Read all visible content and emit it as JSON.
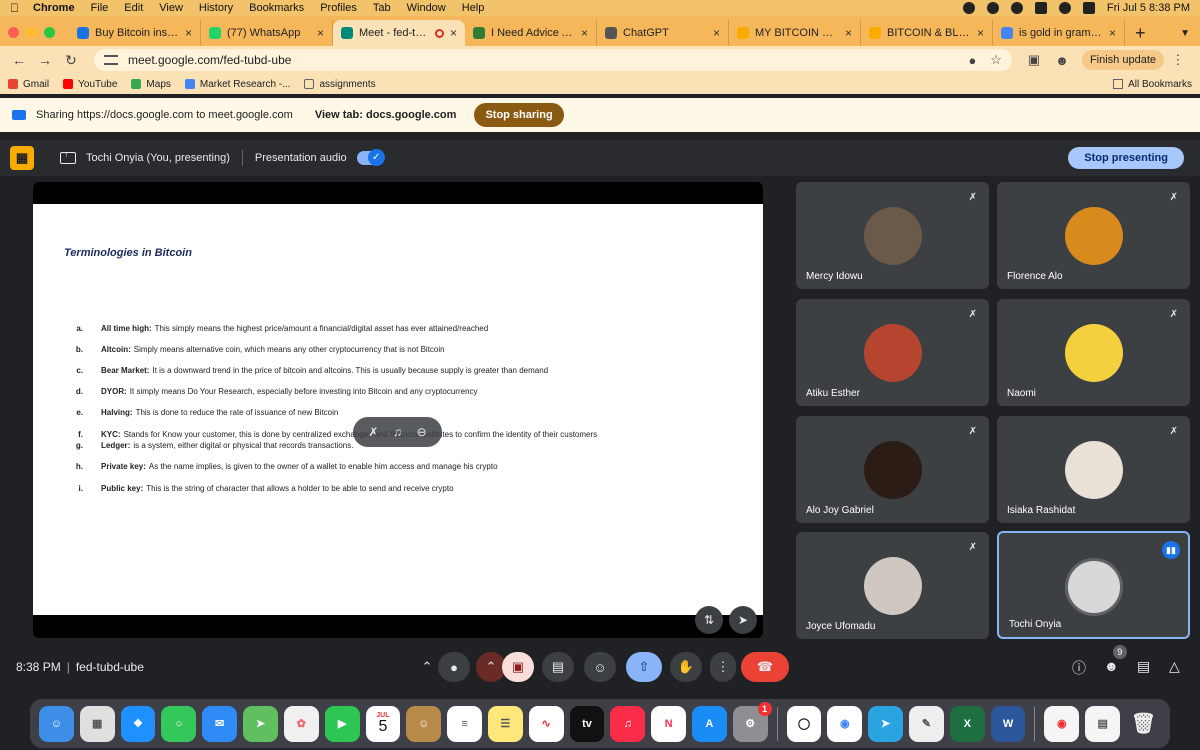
{
  "menubar": {
    "app": "Chrome",
    "items": [
      "File",
      "Edit",
      "View",
      "History",
      "Bookmarks",
      "Profiles",
      "Tab",
      "Window",
      "Help"
    ],
    "datetime": "Fri Jul 5  8:38 PM"
  },
  "tabs": [
    {
      "title": "Buy Bitcoin instantly |",
      "favicon_color": "#1a73e8"
    },
    {
      "title": "(77) WhatsApp",
      "favicon_color": "#25d366"
    },
    {
      "title": "Meet - fed-tubd-u",
      "favicon_color": "#00897b"
    },
    {
      "title": "I Need Advice About M",
      "favicon_color": "#2e7d32"
    },
    {
      "title": "ChatGPT",
      "favicon_color": "#555555"
    },
    {
      "title": "MY BITCOIN COU",
      "favicon_color": "#f9ab00"
    },
    {
      "title": "BITCOIN & BLOCKCHA",
      "favicon_color": "#f9ab00"
    },
    {
      "title": "is gold in gram the sa",
      "favicon_color": "#4285f4"
    }
  ],
  "toolbar": {
    "url": "meet.google.com/fed-tubd-ube",
    "finish_update": "Finish update"
  },
  "bookmarks": {
    "items": [
      {
        "label": "Gmail",
        "color": "#ea4335"
      },
      {
        "label": "YouTube",
        "color": "#ff0000"
      },
      {
        "label": "Maps",
        "color": "#34a853"
      },
      {
        "label": "Market Research -...",
        "color": "#4285f4"
      },
      {
        "label": "assignments",
        "color": "#5f6368"
      }
    ],
    "all": "All Bookmarks"
  },
  "share_banner": {
    "text": "Sharing https://docs.google.com to meet.google.com",
    "view_tab": "View tab: docs.google.com",
    "stop_button": "Stop sharing"
  },
  "meet_header": {
    "presenter": "Tochi Onyia (You, presenting)",
    "presentation_audio": "Presentation audio",
    "stop_presenting": "Stop presenting"
  },
  "slide": {
    "title": "Terminologies in Bitcoin",
    "terms": [
      {
        "letter": "a.",
        "name": "All time high:",
        "text": "This simply means the highest price/amount a financial/digital asset has ever attained/reached"
      },
      {
        "letter": "b.",
        "name": "Altcoin:",
        "text": "Simply means alternative coin, which means any other cryptocurrency that is not Bitcoin"
      },
      {
        "letter": "c.",
        "name": "Bear Market:",
        "text": "It is a downward trend in the price of bitcoin and altcoins. This is usually because supply is greater than demand"
      },
      {
        "letter": "d.",
        "name": "DYOR:",
        "text": "It simply means Do Your Research, especially before investing into Bitcoin and any cryptocurrency"
      },
      {
        "letter": "e.",
        "name": "Halving:",
        "text": "This is done to reduce the rate of issuance of new Bitcoin"
      },
      {
        "letter": "f.",
        "name": "KYC:",
        "text": "Stands for Know your customer, this is done by centralized exchanges and financial institutes to confirm the identity of their customers"
      },
      {
        "letter": "g.",
        "name": "Ledger:",
        "text": "is a system, either digital or physical that records transactions."
      },
      {
        "letter": "h.",
        "name": "Private key:",
        "text": "As the name implies, is given to the owner of a wallet to enable him access and manage his crypto"
      },
      {
        "letter": "i.",
        "name": "Public key:",
        "text": "This is the string of character that allows a holder to be able to send and receive crypto"
      }
    ]
  },
  "participants": [
    {
      "name": "Mercy Idowu",
      "avatar_color": "#6b5a4a"
    },
    {
      "name": "Florence Alo",
      "avatar_color": "#d98a1c"
    },
    {
      "name": "Atiku Esther",
      "avatar_color": "#b5452f"
    },
    {
      "name": "Naomi",
      "avatar_color": "#f4d03f"
    },
    {
      "name": "Alo Joy Gabriel",
      "avatar_color": "#2b1d16"
    },
    {
      "name": "Isiaka Rashidat",
      "avatar_color": "#e9e1d6"
    },
    {
      "name": "Joyce Ufomadu",
      "avatar_color": "#cfc7c0"
    },
    {
      "name": "Tochi Onyia",
      "avatar_color": "#d8d8d8"
    }
  ],
  "bottom": {
    "time": "8:38 PM",
    "meeting_code": "fed-tubd-ube",
    "people_count": "9"
  },
  "dock": {
    "calendar_month": "JUL",
    "calendar_day": "5",
    "tv_label": "tv",
    "settings_badge": "1"
  }
}
